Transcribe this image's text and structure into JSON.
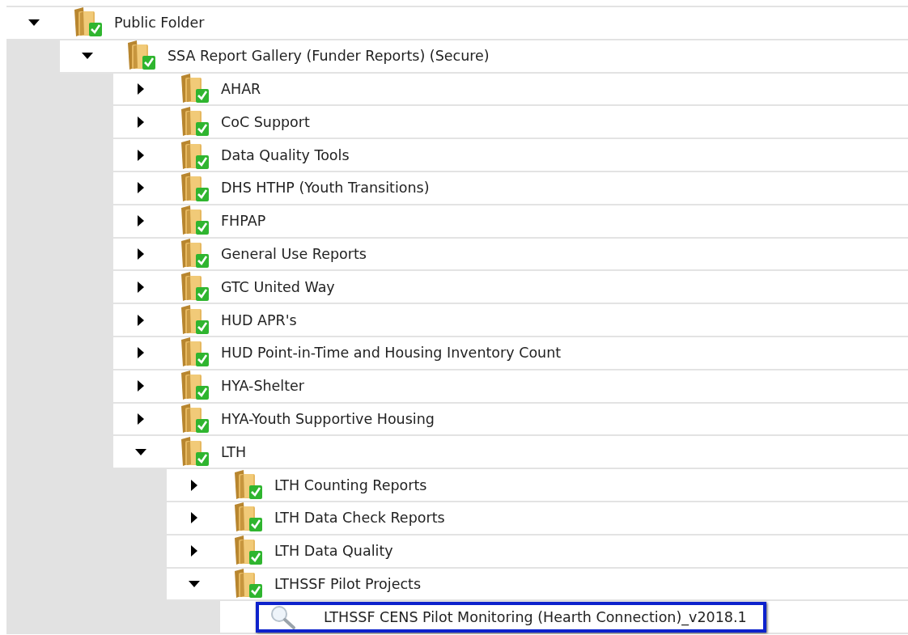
{
  "tree": [
    {
      "label": "Public Folder",
      "kind": "folder",
      "expanded": true,
      "children": [
        {
          "label": "SSA Report Gallery (Funder Reports) (Secure)",
          "kind": "folder",
          "expanded": true,
          "children": [
            {
              "label": "AHAR",
              "kind": "folder",
              "expanded": false
            },
            {
              "label": "CoC Support",
              "kind": "folder",
              "expanded": false
            },
            {
              "label": "Data Quality Tools",
              "kind": "folder",
              "expanded": false
            },
            {
              "label": "DHS HTHP (Youth Transitions)",
              "kind": "folder",
              "expanded": false
            },
            {
              "label": "FHPAP",
              "kind": "folder",
              "expanded": false
            },
            {
              "label": "General Use Reports",
              "kind": "folder",
              "expanded": false
            },
            {
              "label": "GTC United Way",
              "kind": "folder",
              "expanded": false
            },
            {
              "label": "HUD APR's",
              "kind": "folder",
              "expanded": false
            },
            {
              "label": "HUD Point-in-Time and Housing Inventory Count",
              "kind": "folder",
              "expanded": false
            },
            {
              "label": "HYA-Shelter",
              "kind": "folder",
              "expanded": false
            },
            {
              "label": "HYA-Youth Supportive Housing",
              "kind": "folder",
              "expanded": false
            },
            {
              "label": "LTH",
              "kind": "folder",
              "expanded": true,
              "children": [
                {
                  "label": "LTH Counting Reports",
                  "kind": "folder",
                  "expanded": false
                },
                {
                  "label": "LTH Data Check Reports",
                  "kind": "folder",
                  "expanded": false
                },
                {
                  "label": "LTH Data Quality",
                  "kind": "folder",
                  "expanded": false
                },
                {
                  "label": "LTHSSF Pilot Projects",
                  "kind": "folder",
                  "expanded": true,
                  "children": [
                    {
                      "label": "LTHSSF CENS Pilot Monitoring (Hearth Connection)_v2018.1",
                      "kind": "report",
                      "selected": true
                    }
                  ]
                }
              ]
            }
          ]
        }
      ]
    }
  ]
}
